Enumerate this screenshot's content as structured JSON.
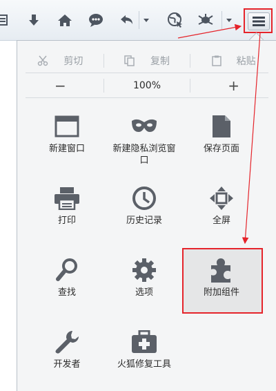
{
  "menu": {
    "edit": {
      "cut": "剪切",
      "copy": "复制",
      "paste": "粘贴"
    },
    "zoom": {
      "minus": "−",
      "level": "100%",
      "plus": "+"
    },
    "items": [
      {
        "label": "新建窗口"
      },
      {
        "label": "新建隐私浏览窗口"
      },
      {
        "label": "保存页面"
      },
      {
        "label": "打印"
      },
      {
        "label": "历史记录"
      },
      {
        "label": "全屏"
      },
      {
        "label": "查找"
      },
      {
        "label": "选项"
      },
      {
        "label": "附加组件"
      },
      {
        "label": "开发者"
      },
      {
        "label": "火狐修复工具"
      }
    ]
  },
  "colors": {
    "icon": "#5b6068",
    "highlight": "#e5232a",
    "panel": "#f4f5f6"
  }
}
